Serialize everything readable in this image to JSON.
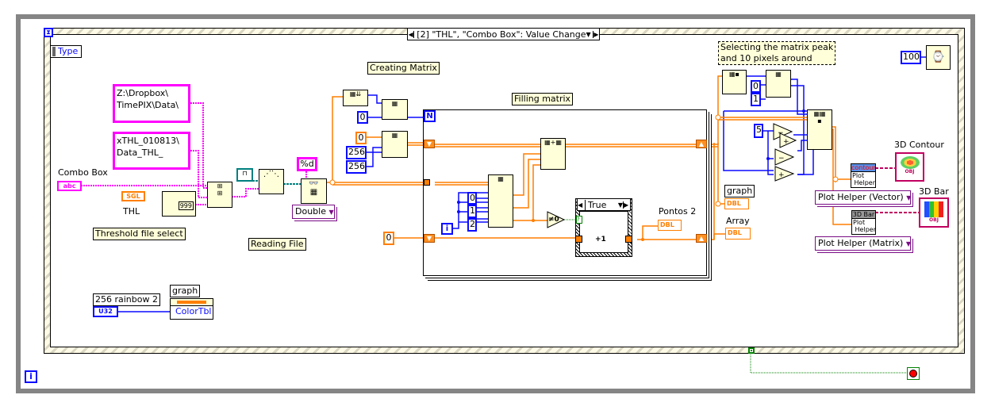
{
  "event_structure": {
    "selector": "[2] \"THL\", \"Combo Box\": Value Change",
    "type_label": "Type"
  },
  "controls": {
    "combo_box_label": "Combo Box",
    "combo_box_type": "abc",
    "thl_label": "THL",
    "thl_type": "SGL"
  },
  "constants": {
    "path1": "Z:\\Dropbox\\\nTimePIX\\Data\\",
    "path2": "xTHL_010813\\\nData_THL_",
    "format": "%d",
    "read_type": "Double",
    "zero_blue": "0",
    "zero_orange": "0",
    "rows": "256",
    "cols": "256",
    "shift_init": "0",
    "idx0": "0",
    "idx1": "1",
    "idx2": "2",
    "peak0": "0",
    "peak1": "1",
    "pixels": "5",
    "wait_ms": "100",
    "colortable_label": "256 rainbow 2",
    "colortable_type": "U32",
    "counter_n": "N",
    "iteration_i": "i",
    "format_999": "999"
  },
  "comments": {
    "threshold": "Threshold file select",
    "reading": "Reading File",
    "creating": "Creating Matrix",
    "filling": "Filling matrix",
    "selecting": "Selecting the matrix peak\nand 10 pixels around"
  },
  "for_loop": {
    "case_selector": "True",
    "not_zero": "≠0",
    "increment": "+1",
    "pontos_label": "Pontos 2",
    "pontos_type": "DBL"
  },
  "indicators": {
    "graph_label": "graph",
    "graph_type": "DBL",
    "array_label": "Array",
    "array_type": "DBL",
    "contour_label": "3D Contour",
    "bar_label": "3D Bar",
    "obj_type": "OBJ"
  },
  "plot_helpers": {
    "vector_ring": "Plot Helper (Vector)",
    "matrix_ring": "Plot Helper (Matrix)",
    "contour_header": "contour",
    "bar_header": "3D Bar",
    "body": "Plot\n Helper"
  },
  "property_node": {
    "label": "graph",
    "property": "ColorTbl"
  },
  "colors": {
    "int_wire": "#0a0aff",
    "dbl_wire": "#ff7f00",
    "string_wire": "#ff00ff",
    "bool_wire": "#008000",
    "refnum_wire": "#007f7f",
    "node_bg": "#ffffd9"
  }
}
